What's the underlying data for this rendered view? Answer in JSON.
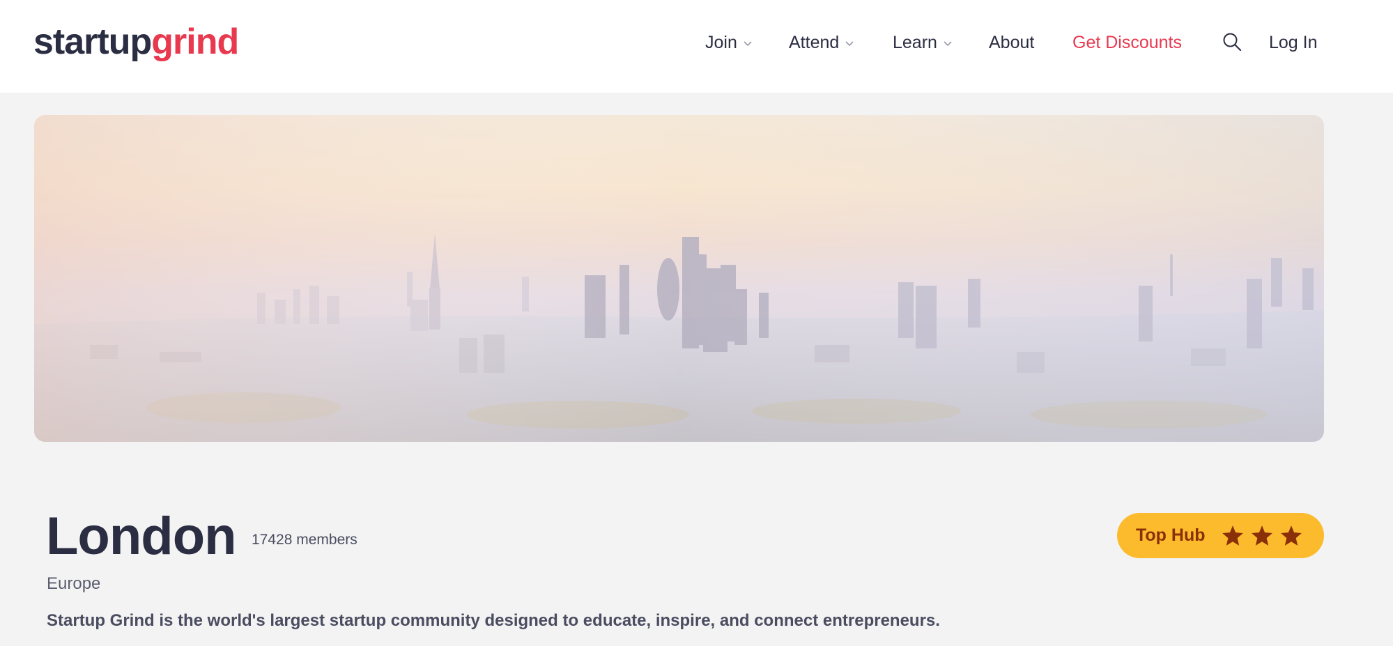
{
  "header": {
    "logo": {
      "part1": "startup",
      "part2": "grind"
    },
    "nav": {
      "join": "Join",
      "attend": "Attend",
      "learn": "Learn",
      "about": "About",
      "discounts": "Get Discounts",
      "login": "Log In"
    },
    "icons": {
      "search": "search-icon",
      "dropdown": "chevron-down-icon"
    }
  },
  "banner": {
    "image": "London city skyline aerial photo"
  },
  "hub": {
    "name": "London",
    "members": "17428 members",
    "region": "Europe",
    "tagline": "Startup Grind is the world's largest startup community designed to educate, inspire, and connect entrepreneurs.",
    "badge": {
      "label": "Top Hub",
      "stars": 3
    }
  },
  "colors": {
    "accent": "#e8394f",
    "text": "#2b2d42",
    "badge": "#fbbb2d",
    "badge_text": "#8a2f08",
    "background": "#f3f3f3"
  }
}
